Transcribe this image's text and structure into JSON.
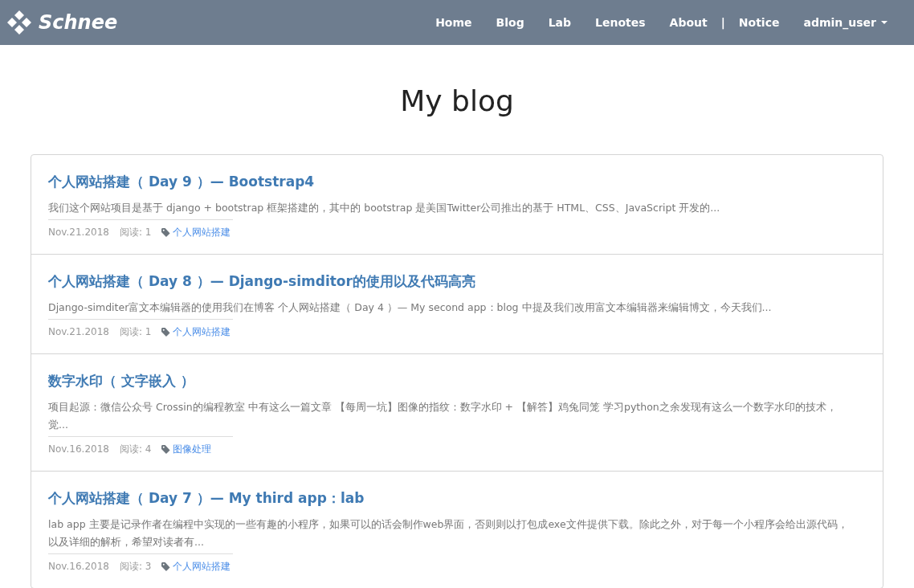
{
  "navbar": {
    "brand": "Schnee",
    "links": [
      {
        "label": "Home"
      },
      {
        "label": "Blog"
      },
      {
        "label": "Lab"
      },
      {
        "label": "Lenotes"
      },
      {
        "label": "About"
      }
    ],
    "separator": "|",
    "notice": "Notice",
    "user": "admin_user"
  },
  "heading": "My blog",
  "posts": [
    {
      "title": "个人网站搭建（ Day 9 ）— Bootstrap4",
      "excerpt": "我们这个网站项目是基于 django + bootstrap 框架搭建的，其中的 bootstrap 是美国Twitter公司推出的基于 HTML、CSS、JavaScript 开发的...",
      "date": "Nov.21.2018",
      "reads": "阅读: 1",
      "tag": "个人网站搭建"
    },
    {
      "title": "个人网站搭建（ Day 8 ）— Django-simditor的使用以及代码高亮",
      "excerpt": "Django-simditer富文本编辑器的使用我们在博客 个人网站搭建（ Day 4 ）— My second app：blog 中提及我们改用富文本编辑器来编辑博文，今天我们...",
      "date": "Nov.21.2018",
      "reads": "阅读: 1",
      "tag": "个人网站搭建"
    },
    {
      "title": "数字水印（ 文字嵌入 ）",
      "excerpt": "项目起源：微信公众号 Crossin的编程教室 中有这么一篇文章 【每周一坑】图像的指纹：数字水印 + 【解答】鸡兔同笼 学习python之余发现有这么一个数字水印的技术，觉...",
      "date": "Nov.16.2018",
      "reads": "阅读: 4",
      "tag": "图像处理"
    },
    {
      "title": "个人网站搭建（ Day 7 ）— My third app：lab",
      "excerpt": "lab app 主要是记录作者在编程中实现的一些有趣的小程序，如果可以的话会制作web界面，否则则以打包成exe文件提供下载。除此之外，对于每一个小程序会给出源代码，以及详细的解析，希望对读者有...",
      "date": "Nov.16.2018",
      "reads": "阅读: 3",
      "tag": "个人网站搭建"
    }
  ]
}
